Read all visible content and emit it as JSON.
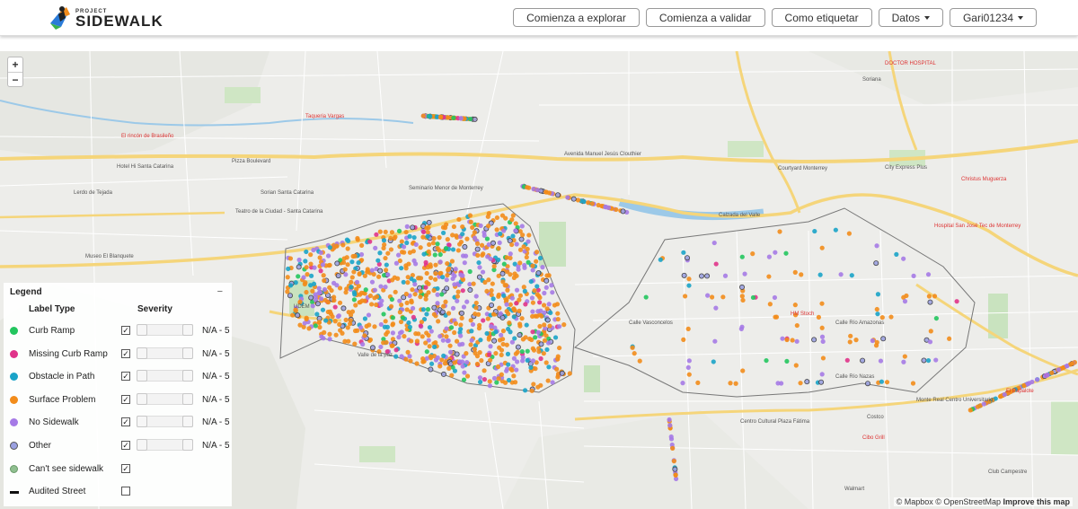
{
  "header": {
    "logo_small": "PROJECT",
    "logo_big": "SIDEWALK",
    "nav": [
      {
        "label": "Comienza a explorar"
      },
      {
        "label": "Comienza a validar"
      },
      {
        "label": "Como etiquetar"
      },
      {
        "label": "Datos",
        "dropdown": true
      },
      {
        "label": "Gari01234",
        "dropdown": true
      }
    ]
  },
  "zoom": {
    "in": "+",
    "out": "−"
  },
  "legend": {
    "title": "Legend",
    "collapse": "−",
    "col_label_type": "Label Type",
    "col_severity": "Severity",
    "rows": [
      {
        "label": "Curb Ramp",
        "color": "#22c55e",
        "checked": true,
        "slider": true,
        "range": "N/A - 5"
      },
      {
        "label": "Missing Curb Ramp",
        "color": "#e0338a",
        "checked": true,
        "slider": true,
        "range": "N/A - 5"
      },
      {
        "label": "Obstacle in Path",
        "color": "#1aa3c8",
        "checked": true,
        "slider": true,
        "range": "N/A - 5"
      },
      {
        "label": "Surface Problem",
        "color": "#f28c1b",
        "checked": true,
        "slider": true,
        "range": "N/A - 5"
      },
      {
        "label": "No Sidewalk",
        "color": "#a57ae6",
        "checked": true,
        "slider": true,
        "range": "N/A - 5"
      },
      {
        "label": "Other",
        "color": "#9aa0e0",
        "checked": true,
        "slider": true,
        "range": "N/A - 5"
      },
      {
        "label": "Can't see sidewalk",
        "color": "#8fbf8f",
        "checked": true,
        "slider": false,
        "range": ""
      },
      {
        "label": "Audited Street",
        "color": "#111111",
        "checked": false,
        "slider": false,
        "range": "",
        "line": true
      }
    ]
  },
  "attribution": {
    "mapbox": "© Mapbox",
    "osm": "© OpenStreetMap",
    "improve": "Improve this map"
  },
  "map_labels": [
    {
      "text": "Avenida Manuel Jesús Clouthier"
    },
    {
      "text": "Hotel Hi Santa Catarina"
    },
    {
      "text": "Seminario Menor de Monterrey"
    },
    {
      "text": "UDEM"
    },
    {
      "text": "Valle de la paz"
    },
    {
      "text": "Centro Cultural Plaza Fátima"
    },
    {
      "text": "Monte Real Centro Universitario"
    },
    {
      "text": "Club Campestre"
    },
    {
      "text": "Hospital San José Tec de Monterrey"
    },
    {
      "text": "Christus Muguerza"
    },
    {
      "text": "Courtyard Monterrey"
    },
    {
      "text": "City Express Plus"
    },
    {
      "text": "El Papalote"
    },
    {
      "text": "Taqueria Vargas"
    },
    {
      "text": "El rincón de Brasileño"
    },
    {
      "text": "Soriana"
    },
    {
      "text": "Sorian Santa Catarina"
    },
    {
      "text": "Calle Río Nazas"
    },
    {
      "text": "Calle Río Amazonas"
    },
    {
      "text": "Calle Vasconcelos"
    },
    {
      "text": "Calzada del Valle"
    },
    {
      "text": "DOCTOR HOSPITAL"
    },
    {
      "text": "Pizza Boulevard"
    },
    {
      "text": "Teatro de la Ciudad - Santa Catarina"
    },
    {
      "text": "Museo El Blanquete"
    },
    {
      "text": "Lerdo de Tejada"
    },
    {
      "text": "Walmart"
    },
    {
      "text": "Costco"
    },
    {
      "text": "Cibo Grill"
    },
    {
      "text": "HM Stoch"
    }
  ]
}
